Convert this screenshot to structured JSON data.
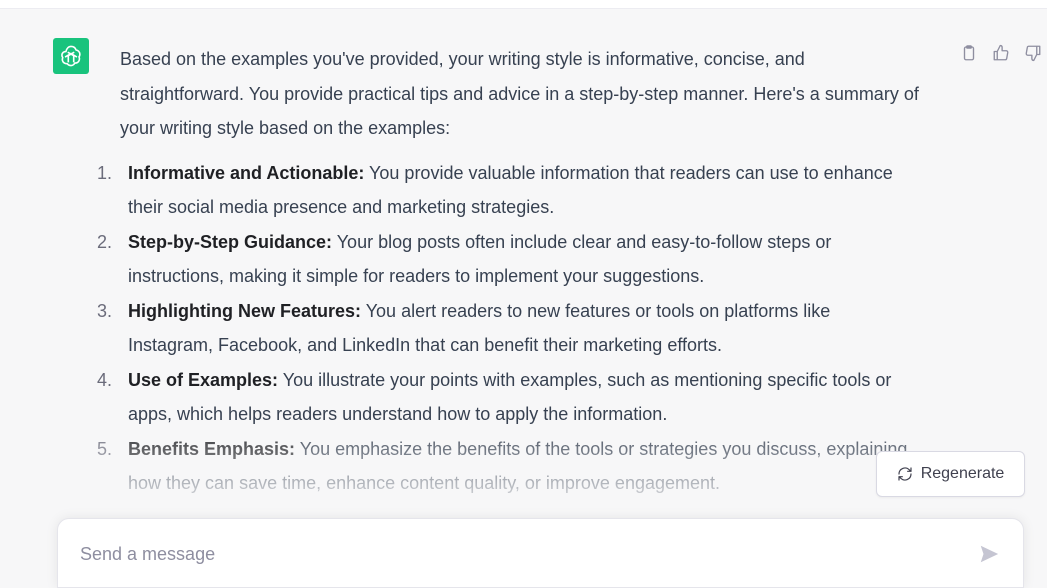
{
  "message": {
    "intro": "Based on the examples you've provided, your writing style is informative, concise, and straightforward. You provide practical tips and advice in a step-by-step manner. Here's a summary of your writing style based on the examples:",
    "items": [
      {
        "number": "1.",
        "title": "Informative and Actionable:",
        "text": " You provide valuable information that readers can use to enhance their social media presence and marketing strategies."
      },
      {
        "number": "2.",
        "title": "Step-by-Step Guidance:",
        "text": " Your blog posts often include clear and easy-to-follow steps or instructions, making it simple for readers to implement your suggestions."
      },
      {
        "number": "3.",
        "title": "Highlighting New Features:",
        "text": " You alert readers to new features or tools on platforms like Instagram, Facebook, and LinkedIn that can benefit their marketing efforts."
      },
      {
        "number": "4.",
        "title": "Use of Examples:",
        "text": " You illustrate your points with examples, such as mentioning specific tools or apps, which helps readers understand how to apply the information."
      },
      {
        "number": "5.",
        "title": "Benefits Emphasis:",
        "text": " You emphasize the benefits of the tools or strategies you discuss, explaining how they can save time, enhance content quality, or improve engagement."
      }
    ]
  },
  "actions": {
    "copy_icon": "clipboard-icon",
    "like_icon": "thumbs-up-icon",
    "dislike_icon": "thumbs-down-icon"
  },
  "regenerate": {
    "label": "Regenerate",
    "icon": "refresh-icon"
  },
  "composer": {
    "placeholder": "Send a message",
    "value": "",
    "send_icon": "send-icon"
  },
  "colors": {
    "avatar_bg": "#19c37d",
    "page_bg": "#f7f7f8"
  }
}
